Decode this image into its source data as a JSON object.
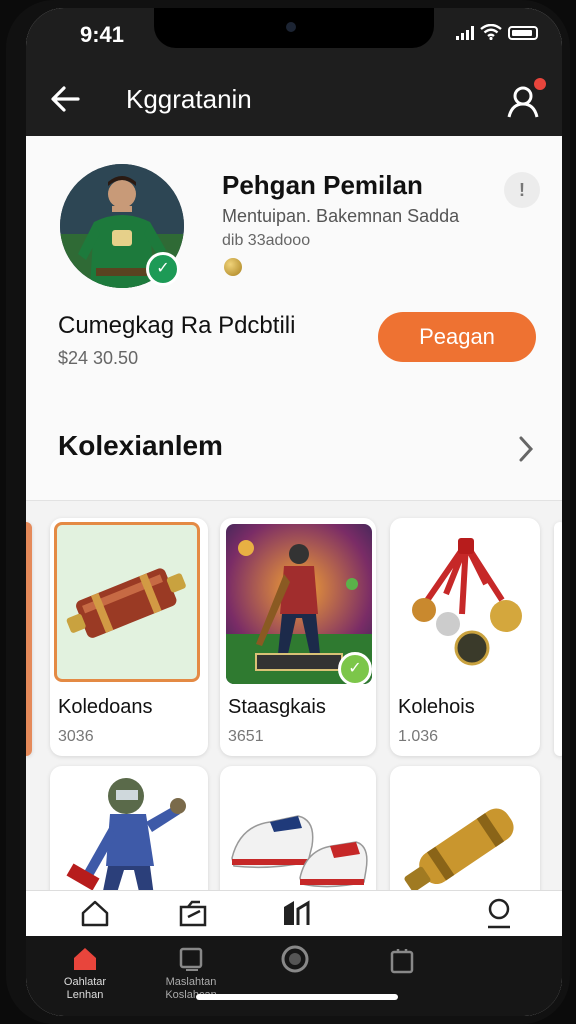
{
  "status": {
    "time": "9:41"
  },
  "appbar": {
    "title": "Kggratanin"
  },
  "profile": {
    "name": "Pehgan Pemilan",
    "subtitle": "Mentuipan. Bakemnan Sadda",
    "meta": "dib 33adooo",
    "card_name": "Cumegkag Ra Pdcbtili",
    "card_price": "$24 30.50",
    "action_label": "Peagan",
    "info_symbol": "!"
  },
  "collection": {
    "title": "Kolexianlem",
    "items": [
      {
        "title": "Koledoans",
        "count": "3036"
      },
      {
        "title": "Staasgkais",
        "count": "3651"
      },
      {
        "title": "Kolehois",
        "count": "1.036"
      }
    ]
  },
  "bottom_nav": {
    "labels": [
      "Oahlatar\nLenhan",
      "Maslahtan\nKoslahcan"
    ]
  },
  "colors": {
    "accent": "#ee7232",
    "dark": "#1e1e1e",
    "badge": "#1d9a56",
    "highlight_border": "#e48a44"
  }
}
